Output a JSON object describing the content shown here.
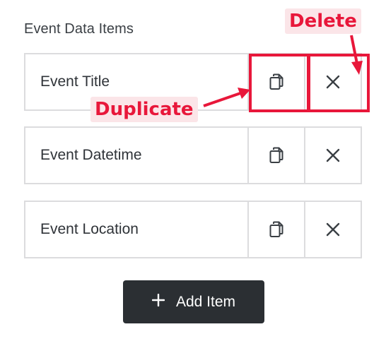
{
  "section": {
    "title": "Event Data Items"
  },
  "items": [
    {
      "label": "Event Title"
    },
    {
      "label": "Event Datetime"
    },
    {
      "label": "Event Location"
    }
  ],
  "add_button": {
    "label": "Add Item",
    "icon": "plus-icon"
  },
  "annotations": {
    "duplicate": "Duplicate",
    "delete": "Delete"
  },
  "colors": {
    "annotation": "#e8173a",
    "annotation_bg": "#fbe5e8",
    "button_bg": "#2b2f33",
    "border": "#dcdcde"
  },
  "icons": {
    "duplicate": "copy-icon",
    "delete": "close-icon"
  }
}
